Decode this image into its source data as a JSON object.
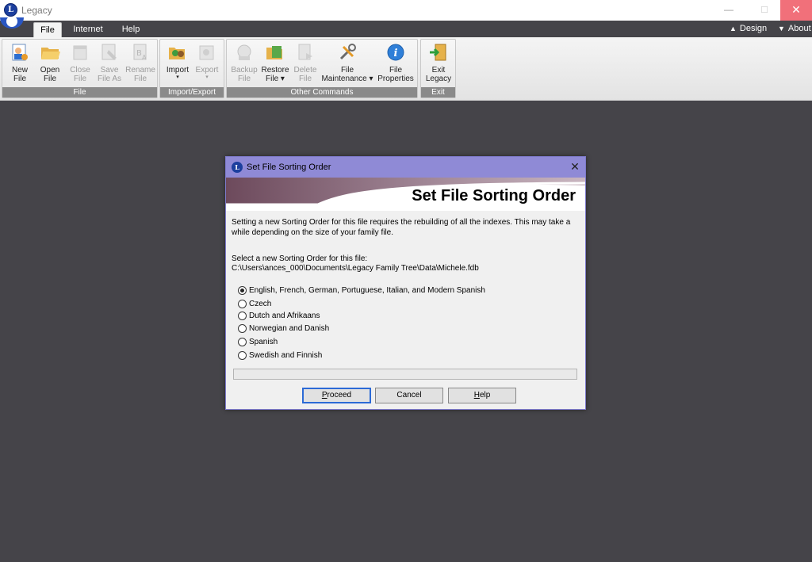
{
  "window": {
    "logo_letter": "L",
    "title": "Legacy",
    "minimize": "—",
    "maximize": "☐",
    "close": "✕"
  },
  "tabs": [
    {
      "label": "File",
      "active": true
    },
    {
      "label": "Internet",
      "active": false
    },
    {
      "label": "Help",
      "active": false
    }
  ],
  "right_links": {
    "design": "Design",
    "about": "About"
  },
  "ribbon": {
    "groups": {
      "file": "File",
      "import_export": "Import/Export",
      "other_commands": "Other Commands",
      "exit": "Exit"
    },
    "buttons": {
      "new_file": {
        "line1": "New",
        "line2": "File",
        "icon": "new-file-icon",
        "enabled": true
      },
      "open_file": {
        "line1": "Open",
        "line2": "File",
        "icon": "folder-icon",
        "enabled": true
      },
      "close_file": {
        "line1": "Close",
        "line2": "File",
        "icon": "close-file-icon",
        "enabled": false
      },
      "save_file_as": {
        "line1": "Save",
        "line2": "File As",
        "icon": "save-as-icon",
        "enabled": false
      },
      "rename_file": {
        "line1": "Rename",
        "line2": "File",
        "icon": "rename-icon",
        "enabled": false
      },
      "import": {
        "line1": "Import",
        "line2": "▾",
        "icon": "import-icon",
        "enabled": true
      },
      "export": {
        "line1": "Export",
        "line2": "▾",
        "icon": "export-icon",
        "enabled": false
      },
      "backup_file": {
        "line1": "Backup",
        "line2": "File",
        "icon": "backup-icon",
        "enabled": false
      },
      "restore_file": {
        "line1": "Restore",
        "line2": "File ▾",
        "icon": "restore-icon",
        "enabled": true
      },
      "delete_file": {
        "line1": "Delete",
        "line2": "File",
        "icon": "delete-file-icon",
        "enabled": false
      },
      "file_maintenance": {
        "line1": "File",
        "line2": "Maintenance ▾",
        "icon": "tools-icon",
        "enabled": true
      },
      "file_properties": {
        "line1": "File",
        "line2": "Properties",
        "icon": "info-icon",
        "enabled": true
      },
      "exit_legacy": {
        "line1": "Exit",
        "line2": "Legacy",
        "icon": "exit-door-icon",
        "enabled": true
      }
    }
  },
  "dialog": {
    "title": "Set File Sorting Order",
    "heading": "Set File Sorting Order",
    "close": "✕",
    "message_line1": "Setting a new Sorting Order for this file requires the rebuilding of all the indexes.  This may take a",
    "message_line2": "while depending on the size of your family file.",
    "select_prompt": "Select a new Sorting Order for this file:",
    "file_path": "C:\\Users\\ances_000\\Documents\\Legacy Family Tree\\Data\\Michele.fdb",
    "options": [
      {
        "label": "English, French, German, Portuguese, Italian, and Modern Spanish",
        "selected": true
      },
      {
        "label": "Czech",
        "selected": false
      },
      {
        "label": "Dutch and Afrikaans",
        "selected": false
      },
      {
        "label": "Norwegian and Danish",
        "selected": false
      },
      {
        "label": "Spanish",
        "selected": false
      },
      {
        "label": "Swedish and Finnish",
        "selected": false
      }
    ],
    "buttons": {
      "proceed_first": "P",
      "proceed_rest": "roceed",
      "cancel": "Cancel",
      "help_first": "H",
      "help_rest": "elp"
    }
  },
  "colors": {
    "workspace": "#454449",
    "dialog_titlebar": "#8f8ad6",
    "close_button": "#f1707a",
    "accent_blue": "#2a56c2"
  }
}
